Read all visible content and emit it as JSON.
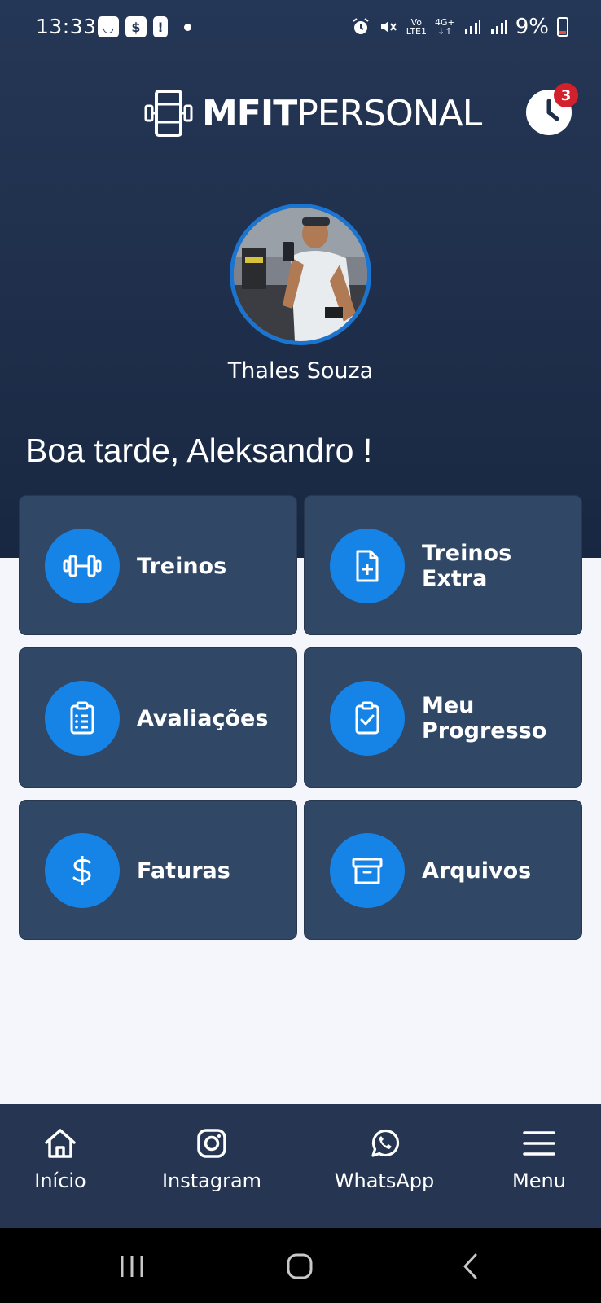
{
  "status_bar": {
    "time": "13:33",
    "battery": "9%",
    "network": "4G+",
    "lte": "LTE1"
  },
  "header": {
    "logo_bold": "MFIT",
    "logo_light": "PERSONAL",
    "notification_count": "3"
  },
  "trainer": {
    "name": "Thales Souza"
  },
  "greeting": "Boa tarde, Aleksandro !",
  "menu": [
    {
      "label": "Treinos",
      "icon": "dumbbell-icon"
    },
    {
      "label": "Treinos Extra",
      "icon": "file-plus-icon"
    },
    {
      "label": "Avaliações",
      "icon": "clipboard-list-icon"
    },
    {
      "label": "Meu Progresso",
      "icon": "clipboard-check-icon"
    },
    {
      "label": "Faturas",
      "icon": "dollar-icon"
    },
    {
      "label": "Arquivos",
      "icon": "archive-icon"
    }
  ],
  "bottom_nav": [
    {
      "label": "Início",
      "icon": "home-icon"
    },
    {
      "label": "Instagram",
      "icon": "instagram-icon"
    },
    {
      "label": "WhatsApp",
      "icon": "whatsapp-icon"
    },
    {
      "label": "Menu",
      "icon": "hamburger-icon"
    }
  ],
  "colors": {
    "header_bg": "#253756",
    "card_bg": "#304766",
    "icon_circle": "#1683e6",
    "badge": "#d3202d",
    "page_bg": "#f4f6fb"
  }
}
